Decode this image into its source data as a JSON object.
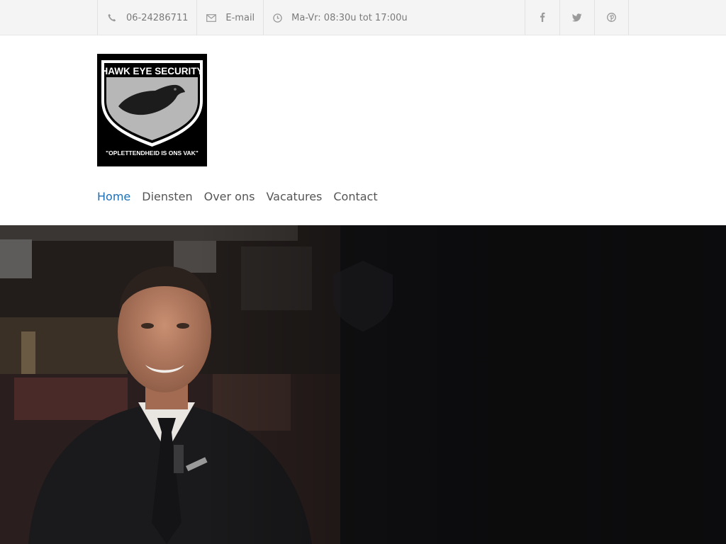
{
  "topbar": {
    "phone": "06-24286711",
    "email_label": "E-mail",
    "hours": "Ma-Vr: 08:30u tot 17:00u",
    "icons": {
      "phone": "phone-icon",
      "email": "envelope-icon",
      "hours": "clock-icon"
    },
    "social": [
      "facebook-icon",
      "twitter-icon",
      "pinterest-icon"
    ]
  },
  "logo": {
    "title": "HAWK EYE SECURITY",
    "slogan": "\"OPLETTENDHEID IS ONS VAK\""
  },
  "nav": {
    "items": [
      {
        "label": "Home",
        "active": true
      },
      {
        "label": "Diensten",
        "active": false
      },
      {
        "label": "Over ons",
        "active": false
      },
      {
        "label": "Vacatures",
        "active": false
      },
      {
        "label": "Contact",
        "active": false
      }
    ]
  },
  "colors": {
    "accent": "#1d6fb5",
    "topbar_bg": "#f4f4f4",
    "text": "#555555"
  }
}
